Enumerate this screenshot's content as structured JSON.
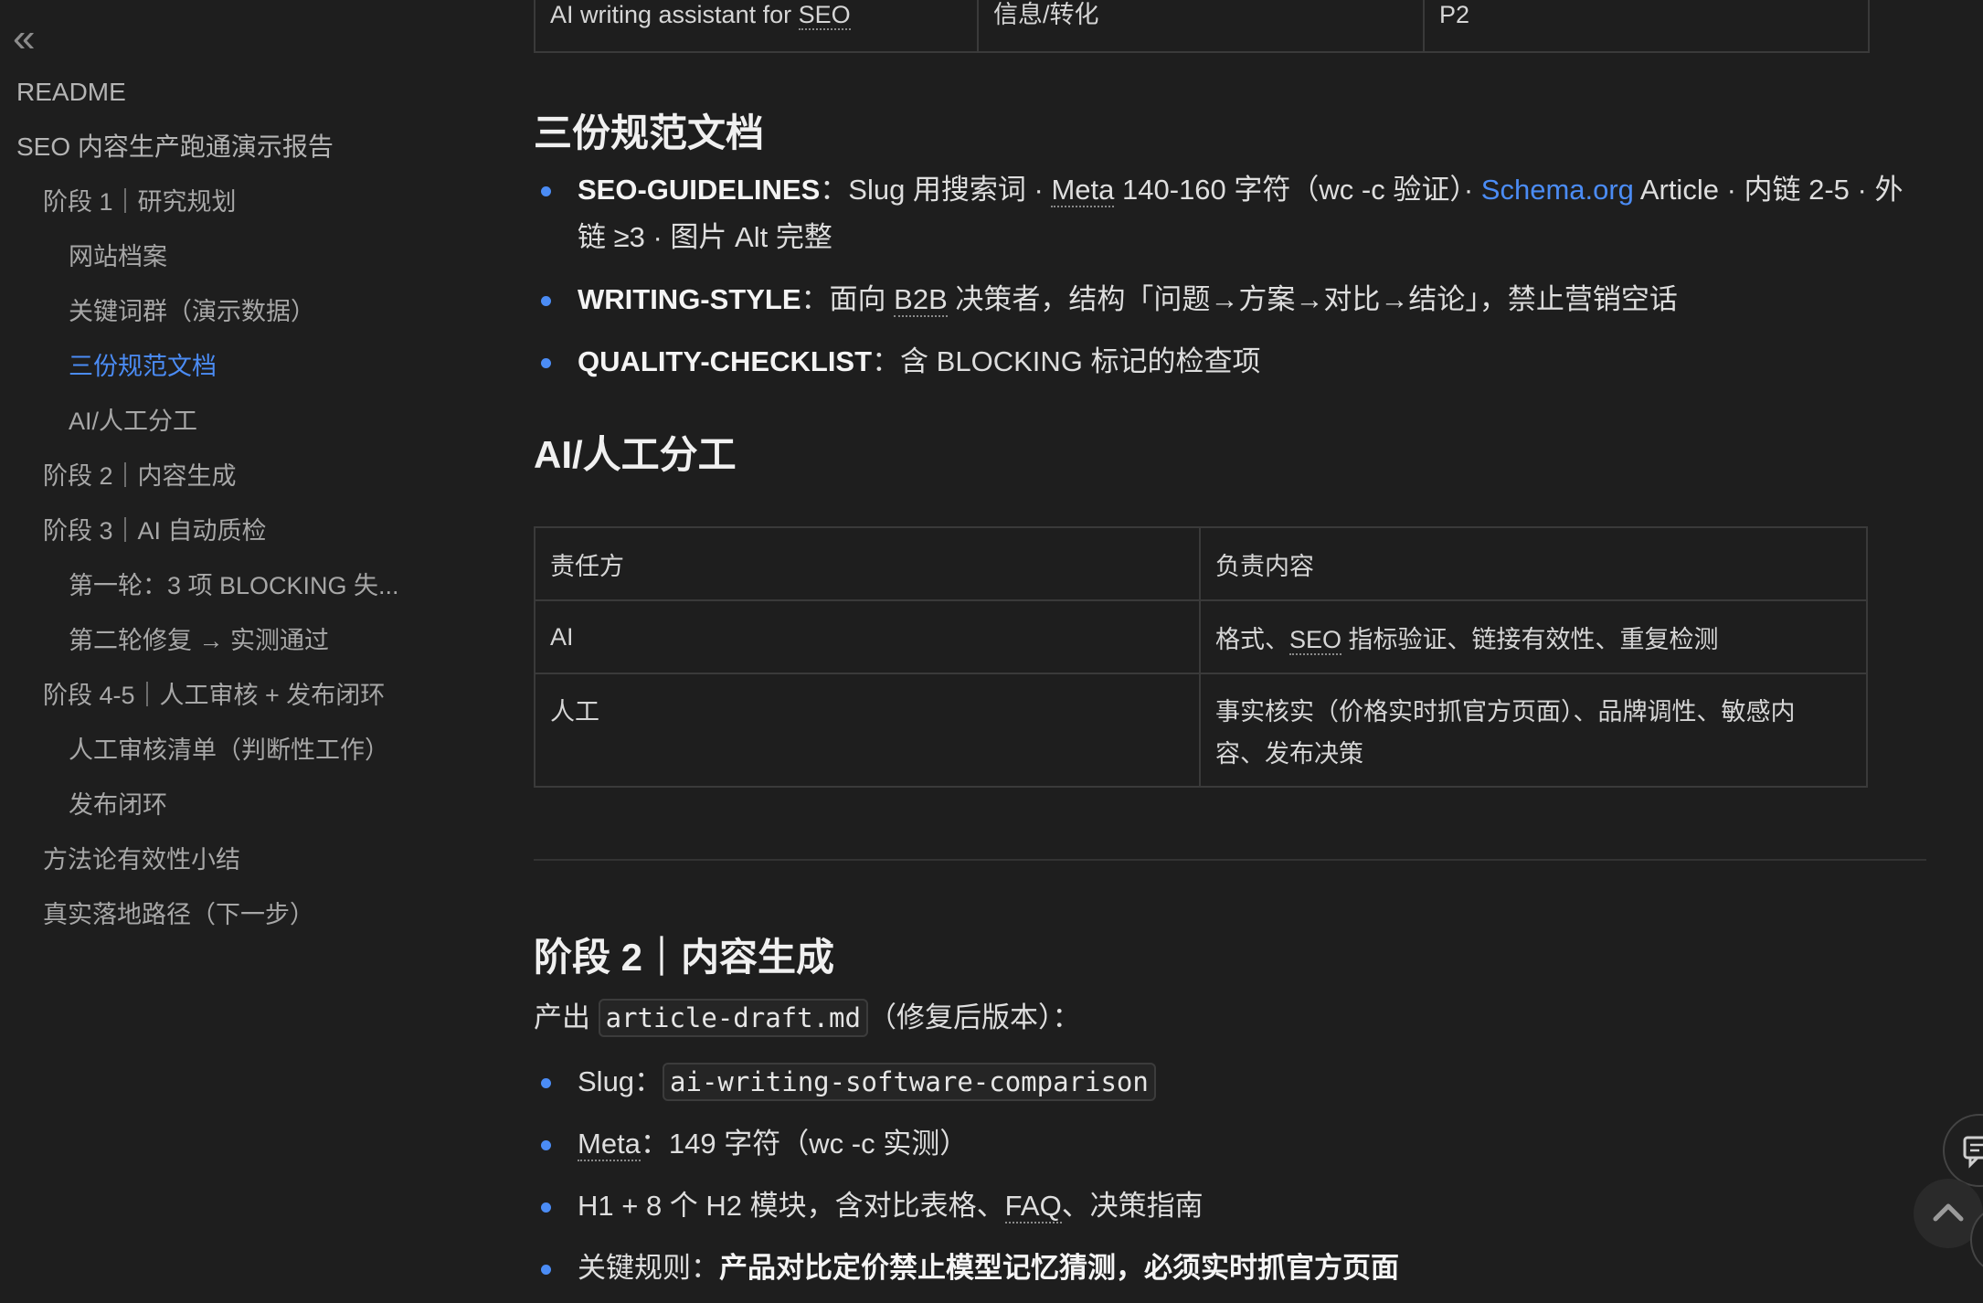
{
  "sidebar": {
    "collapse_glyph": "«",
    "items": [
      {
        "label": "README"
      },
      {
        "label": "SEO 内容生产跑通演示报告"
      },
      {
        "label": "阶段 1｜研究规划"
      },
      {
        "label": "网站档案"
      },
      {
        "label": "关键词群（演示数据）"
      },
      {
        "label": "三份规范文档"
      },
      {
        "label": "AI/人工分工"
      },
      {
        "label": "阶段 2｜内容生成"
      },
      {
        "label": "阶段 3｜AI 自动质检"
      },
      {
        "label": "第一轮：3 项 BLOCKING 失..."
      },
      {
        "label": "第二轮修复 → 实测通过"
      },
      {
        "label": "阶段 4-5｜人工审核 + 发布闭环"
      },
      {
        "label": "人工审核清单（判断性工作）"
      },
      {
        "label": "发布闭环"
      },
      {
        "label": "方法论有效性小结"
      },
      {
        "label": "真实落地路径（下一步）"
      }
    ]
  },
  "top_table_row": {
    "c1_prefix": "AI writing assistant for ",
    "c1_abbr": "SEO",
    "c2": "信息/转化",
    "c3": "P2"
  },
  "sec_docs": {
    "title": "三份规范文档",
    "b1": {
      "key": "SEO-GUIDELINES",
      "t1": "：Slug 用搜索词 · ",
      "abbr": "Meta",
      "t2": " 140-160 字符（wc -c 验证）· ",
      "link": "Schema.org",
      "t3": " Article · 内链 2-5 · 外链 ≥3 · 图片 Alt 完整"
    },
    "b2": {
      "key": "WRITING-STYLE",
      "t1": "：面向 ",
      "abbr": "B2B",
      "t2": " 决策者，结构「问题→方案→对比→结论」，禁止营销空话"
    },
    "b3": {
      "key": "QUALITY-CHECKLIST",
      "t1": "：含 BLOCKING 标记的检查项"
    }
  },
  "sec_roles": {
    "title": "AI/人工分工",
    "header": [
      "责任方",
      "负责内容"
    ],
    "r1_who": "AI",
    "r1_pre": "格式、",
    "r1_abbr": "SEO",
    "r1_post": " 指标验证、链接有效性、重复检测",
    "r2_who": "人工",
    "r2_text": "事实核实（价格实时抓官方页面）、品牌调性、敏感内容、发布决策"
  },
  "sec_stage2": {
    "title": "阶段 2｜内容生成",
    "intro_pre": "产出 ",
    "intro_code": "article-draft.md",
    "intro_post": "（修复后版本）：",
    "slug_label": "Slug：",
    "slug_code": "ai-writing-software-comparison",
    "meta_abbr": "Meta",
    "meta_text": "：149 字符（wc -c 实测）",
    "h_pre": "H1 + 8 个 H2 模块，含对比表格、",
    "h_abbr": "FAQ",
    "h_post": "、决策指南",
    "rule_label": "关键规则：",
    "rule_bold": "产品对比定价禁止模型记忆猜测，必须实时抓官方页面"
  },
  "icons": {
    "chat": "chat-bubble-icon",
    "top": "chevron-up-icon"
  },
  "colors": {
    "accent": "#4b8cf5",
    "background": "#1e1e1e"
  }
}
